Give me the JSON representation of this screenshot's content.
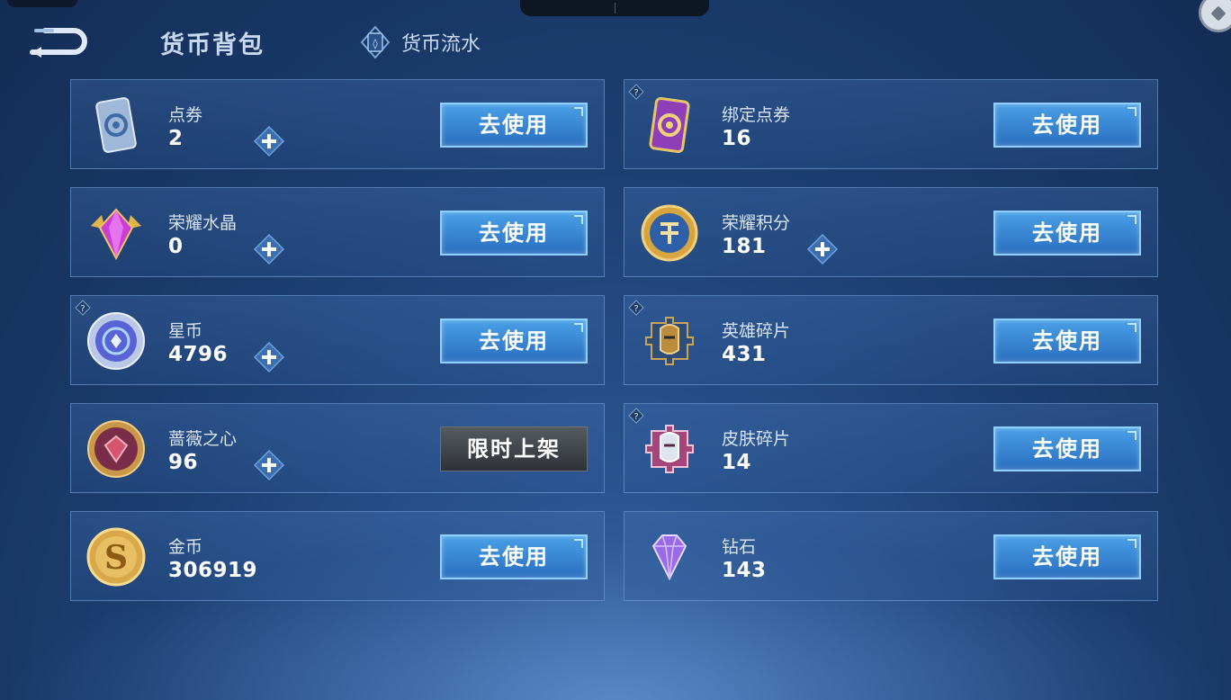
{
  "header": {
    "title": "货币背包",
    "flow_tab": "货币流水"
  },
  "currencies": [
    {
      "name": "点券",
      "amount": "2",
      "action": "去使用"
    },
    {
      "name": "绑定点券",
      "amount": "16",
      "action": "去使用"
    },
    {
      "name": "荣耀水晶",
      "amount": "0",
      "action": "去使用"
    },
    {
      "name": "荣耀积分",
      "amount": "181",
      "action": "去使用"
    },
    {
      "name": "星币",
      "amount": "4796",
      "action": "去使用"
    },
    {
      "name": "英雄碎片",
      "amount": "431",
      "action": "去使用"
    },
    {
      "name": "蔷薇之心",
      "amount": "96",
      "action": "限时上架"
    },
    {
      "name": "皮肤碎片",
      "amount": "14",
      "action": "去使用"
    },
    {
      "name": "金币",
      "amount": "306919",
      "action": "去使用"
    },
    {
      "name": "钻石",
      "amount": "143",
      "action": "去使用"
    }
  ],
  "icons": {
    "points_ticket": "ticket-icon",
    "bound_ticket": "bound-ticket-icon",
    "crystal": "crystal-icon",
    "honor_points": "honor-points-icon",
    "star_coin": "star-coin-icon",
    "hero_shard": "hero-shard-icon",
    "rose_heart": "rose-heart-icon",
    "skin_shard": "skin-shard-icon",
    "gold_coin": "gold-coin-icon",
    "diamond": "diamond-icon"
  },
  "colors": {
    "accent_button": "#3a8ad6",
    "disabled_button": "#3f444a",
    "background": "#1c3f72"
  }
}
